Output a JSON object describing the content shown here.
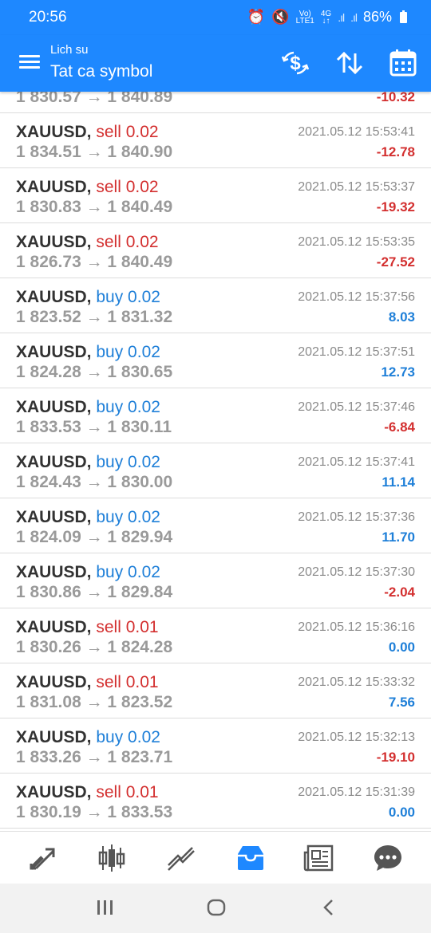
{
  "status_bar": {
    "time": "20:56",
    "network_top": "Vo)",
    "network_bottom": "LTE1",
    "net_gen_top": "4G",
    "net_gen_bottom": "↓↑",
    "battery": "86%"
  },
  "header": {
    "subtitle": "Lich su",
    "title": "Tat ca symbol"
  },
  "trades_partial": {
    "prices": "1 830.57 → 1 840.89",
    "profit": "-10.32"
  },
  "trades": [
    {
      "symbol": "XAUUSD,",
      "side": "sell 0.02",
      "type": "sell",
      "prices": "1 834.51 → 1 840.90",
      "time": "2021.05.12 15:53:41",
      "profit": "-12.78",
      "sign": "neg"
    },
    {
      "symbol": "XAUUSD,",
      "side": "sell 0.02",
      "type": "sell",
      "prices": "1 830.83 → 1 840.49",
      "time": "2021.05.12 15:53:37",
      "profit": "-19.32",
      "sign": "neg"
    },
    {
      "symbol": "XAUUSD,",
      "side": "sell 0.02",
      "type": "sell",
      "prices": "1 826.73 → 1 840.49",
      "time": "2021.05.12 15:53:35",
      "profit": "-27.52",
      "sign": "neg"
    },
    {
      "symbol": "XAUUSD,",
      "side": "buy 0.02",
      "type": "buy",
      "prices": "1 823.52 → 1 831.32",
      "time": "2021.05.12 15:37:56",
      "profit": "8.03",
      "sign": "pos"
    },
    {
      "symbol": "XAUUSD,",
      "side": "buy 0.02",
      "type": "buy",
      "prices": "1 824.28 → 1 830.65",
      "time": "2021.05.12 15:37:51",
      "profit": "12.73",
      "sign": "pos"
    },
    {
      "symbol": "XAUUSD,",
      "side": "buy 0.02",
      "type": "buy",
      "prices": "1 833.53 → 1 830.11",
      "time": "2021.05.12 15:37:46",
      "profit": "-6.84",
      "sign": "neg"
    },
    {
      "symbol": "XAUUSD,",
      "side": "buy 0.02",
      "type": "buy",
      "prices": "1 824.43 → 1 830.00",
      "time": "2021.05.12 15:37:41",
      "profit": "11.14",
      "sign": "pos"
    },
    {
      "symbol": "XAUUSD,",
      "side": "buy 0.02",
      "type": "buy",
      "prices": "1 824.09 → 1 829.94",
      "time": "2021.05.12 15:37:36",
      "profit": "11.70",
      "sign": "pos"
    },
    {
      "symbol": "XAUUSD,",
      "side": "buy 0.02",
      "type": "buy",
      "prices": "1 830.86 → 1 829.84",
      "time": "2021.05.12 15:37:30",
      "profit": "-2.04",
      "sign": "neg"
    },
    {
      "symbol": "XAUUSD,",
      "side": "sell 0.01",
      "type": "sell",
      "prices": "1 830.26 → 1 824.28",
      "time": "2021.05.12 15:36:16",
      "profit": "0.00",
      "sign": "pos"
    },
    {
      "symbol": "XAUUSD,",
      "side": "sell 0.01",
      "type": "sell",
      "prices": "1 831.08 → 1 823.52",
      "time": "2021.05.12 15:33:32",
      "profit": "7.56",
      "sign": "pos"
    },
    {
      "symbol": "XAUUSD,",
      "side": "buy 0.02",
      "type": "buy",
      "prices": "1 833.26 → 1 823.71",
      "time": "2021.05.12 15:32:13",
      "profit": "-19.10",
      "sign": "neg"
    },
    {
      "symbol": "XAUUSD,",
      "side": "sell 0.01",
      "type": "sell",
      "prices": "1 830.19 → 1 833.53",
      "time": "2021.05.12 15:31:39",
      "profit": "0.00",
      "sign": "pos"
    }
  ],
  "bottom_nav": {
    "items": [
      "quotes-icon",
      "chart-icon",
      "trade-icon",
      "history-icon",
      "news-icon",
      "chat-icon"
    ],
    "active": "history-icon"
  },
  "colors": {
    "primary": "#1e88ff",
    "sell": "#d32f2f",
    "buy": "#1e7fd8",
    "price_gray": "#9a9a9a",
    "nav_icon": "#555555"
  }
}
